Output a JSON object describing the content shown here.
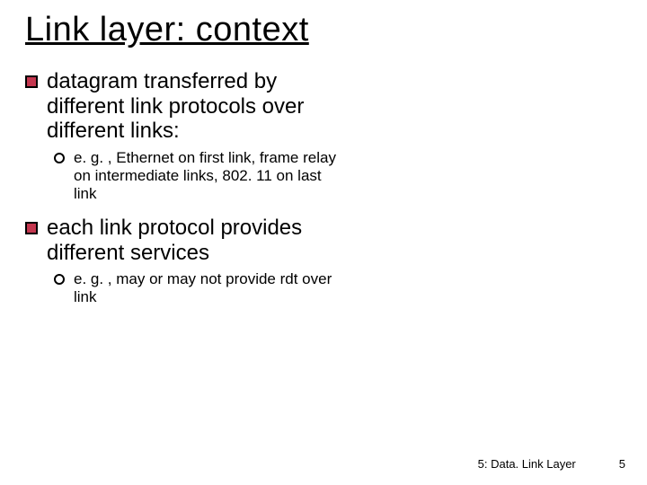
{
  "title": "Link layer: context",
  "bullets": [
    {
      "text": "datagram transferred by different link protocols over different links:",
      "sub": [
        "e. g. , Ethernet on first link, frame relay on intermediate links, 802. 11 on last link"
      ]
    },
    {
      "text": "each  link protocol provides different services",
      "sub": [
        "e. g. , may or may not provide rdt over link"
      ]
    }
  ],
  "footer": {
    "section": "5: Data. Link Layer",
    "page": "5"
  },
  "colors": {
    "bullet_fill": "#c4374f"
  }
}
